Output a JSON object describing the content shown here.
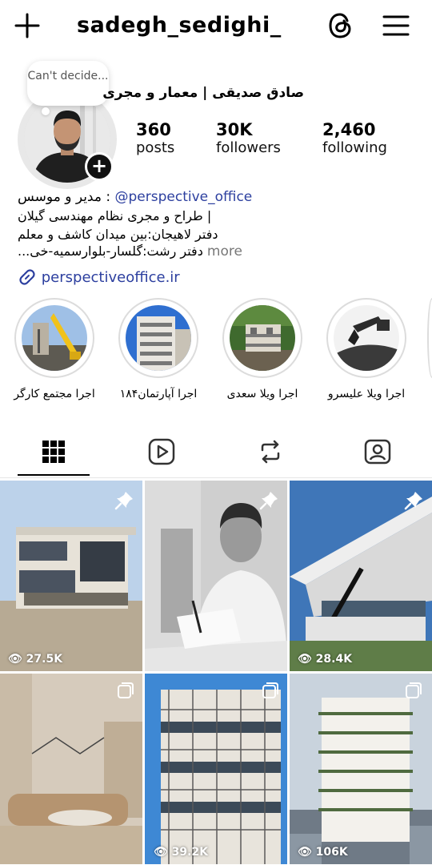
{
  "header": {
    "username": "sadegh_sedighi_",
    "plus_icon": "plus-icon",
    "threads_icon": "threads-icon",
    "menu_icon": "hamburger-menu-icon"
  },
  "profile": {
    "note": "Can't decide...",
    "full_name": "صادق صدیقی | معمار و مجری",
    "stats": [
      {
        "value": "360",
        "label": "posts"
      },
      {
        "value": "30K",
        "label": "followers"
      },
      {
        "value": "2,460",
        "label": "following"
      }
    ],
    "bio": {
      "line1_mention": "@perspective_office",
      "line1_text": ": مدیر و موسس",
      "line2": "| طراح و مجری نظام مهندسی گیلان",
      "line3": "دفتر لاهیجان:بین میدان کاشف و معلم",
      "line4": "دفتر رشت:گلسار-بلوارسمیه-خی...",
      "more": "more"
    },
    "link": "perspectiveoffice.ir"
  },
  "highlights": [
    {
      "label": "اجرا مجتمع کارگر"
    },
    {
      "label": "اجرا آپارتمان۱۸۴"
    },
    {
      "label": "اجرا ویلا سعدی"
    },
    {
      "label": "اجرا ویلا علیسرو"
    }
  ],
  "tabs": [
    {
      "name": "grid",
      "icon": "grid-icon"
    },
    {
      "name": "reels",
      "icon": "reels-icon"
    },
    {
      "name": "reposts",
      "icon": "repost-icon"
    },
    {
      "name": "tagged",
      "icon": "tagged-icon"
    }
  ],
  "posts": [
    {
      "views": "27.5K",
      "pinned": true
    },
    {
      "views": "",
      "pinned": true
    },
    {
      "views": "28.4K",
      "pinned": true
    },
    {
      "views": "",
      "multi": true
    },
    {
      "views": "39.2K",
      "multi": true
    },
    {
      "views": "106K",
      "multi": true
    }
  ],
  "colors": {
    "link": "#2c3f9f",
    "muted": "#777777"
  }
}
